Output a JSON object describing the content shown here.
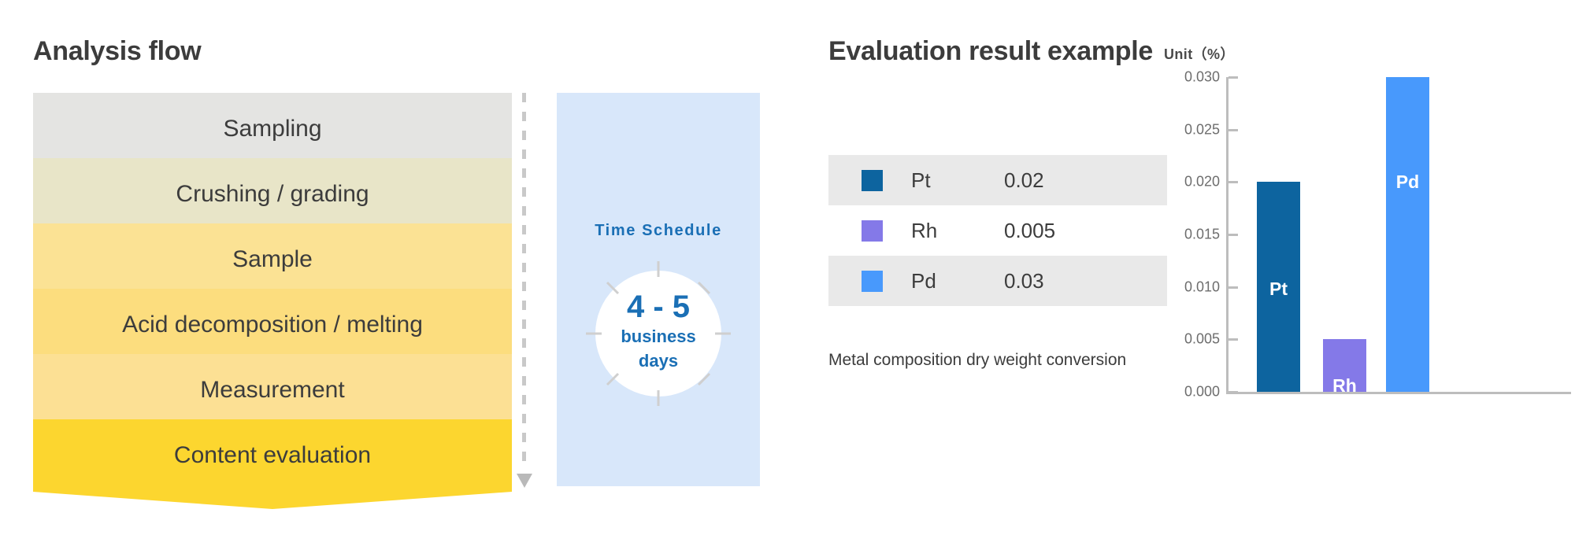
{
  "flow": {
    "title": "Analysis flow",
    "steps": [
      {
        "label": "Sampling",
        "color": "#e4e4e2"
      },
      {
        "label": "Crushing / grading",
        "color": "#e8e5c8"
      },
      {
        "label": "Sample",
        "color": "#fbe294"
      },
      {
        "label": "Acid decomposition / melting",
        "color": "#fcdd7e"
      },
      {
        "label": "Measurement",
        "color": "#fce094"
      },
      {
        "label": "Content evaluation",
        "color": "#fcd62f"
      }
    ]
  },
  "divider": {
    "arrow_icon": "triangle-down-icon"
  },
  "schedule": {
    "title": "Time Schedule",
    "clock_icon": "clock-icon",
    "days": "4 - 5",
    "unit_line1": "business",
    "unit_line2": "days",
    "panel_color": "#d8e7fa",
    "accent_color": "#1a6fb5"
  },
  "result": {
    "title": "Evaluation result example",
    "unit": "Unit（%）",
    "note": "Metal composition dry weight conversion",
    "legend": [
      {
        "name": "Pt",
        "value": "0.02",
        "color": "#0d649f",
        "shaded": true
      },
      {
        "name": "Rh",
        "value": "0.005",
        "color": "#8479e8",
        "shaded": false
      },
      {
        "name": "Pd",
        "value": "0.03",
        "color": "#4899fc",
        "shaded": true
      }
    ]
  },
  "chart_data": {
    "type": "bar",
    "title": "Evaluation result example",
    "xlabel": "",
    "ylabel": "Unit（%）",
    "ylim": [
      0,
      0.03
    ],
    "ytick_step": 0.005,
    "yticks": [
      "0.000",
      "0.005",
      "0.010",
      "0.015",
      "0.020",
      "0.025",
      "0.030"
    ],
    "ytick_values": [
      0,
      0.005,
      0.01,
      0.015,
      0.02,
      0.025,
      0.03
    ],
    "grid": false,
    "legend_position": "left-table",
    "categories": [
      "Pt",
      "Rh",
      "Pd"
    ],
    "values": [
      0.02,
      0.005,
      0.03
    ],
    "colors": [
      "#0d649f",
      "#8479e8",
      "#4899fc"
    ],
    "annotations": [
      "Metal composition dry weight conversion"
    ]
  }
}
